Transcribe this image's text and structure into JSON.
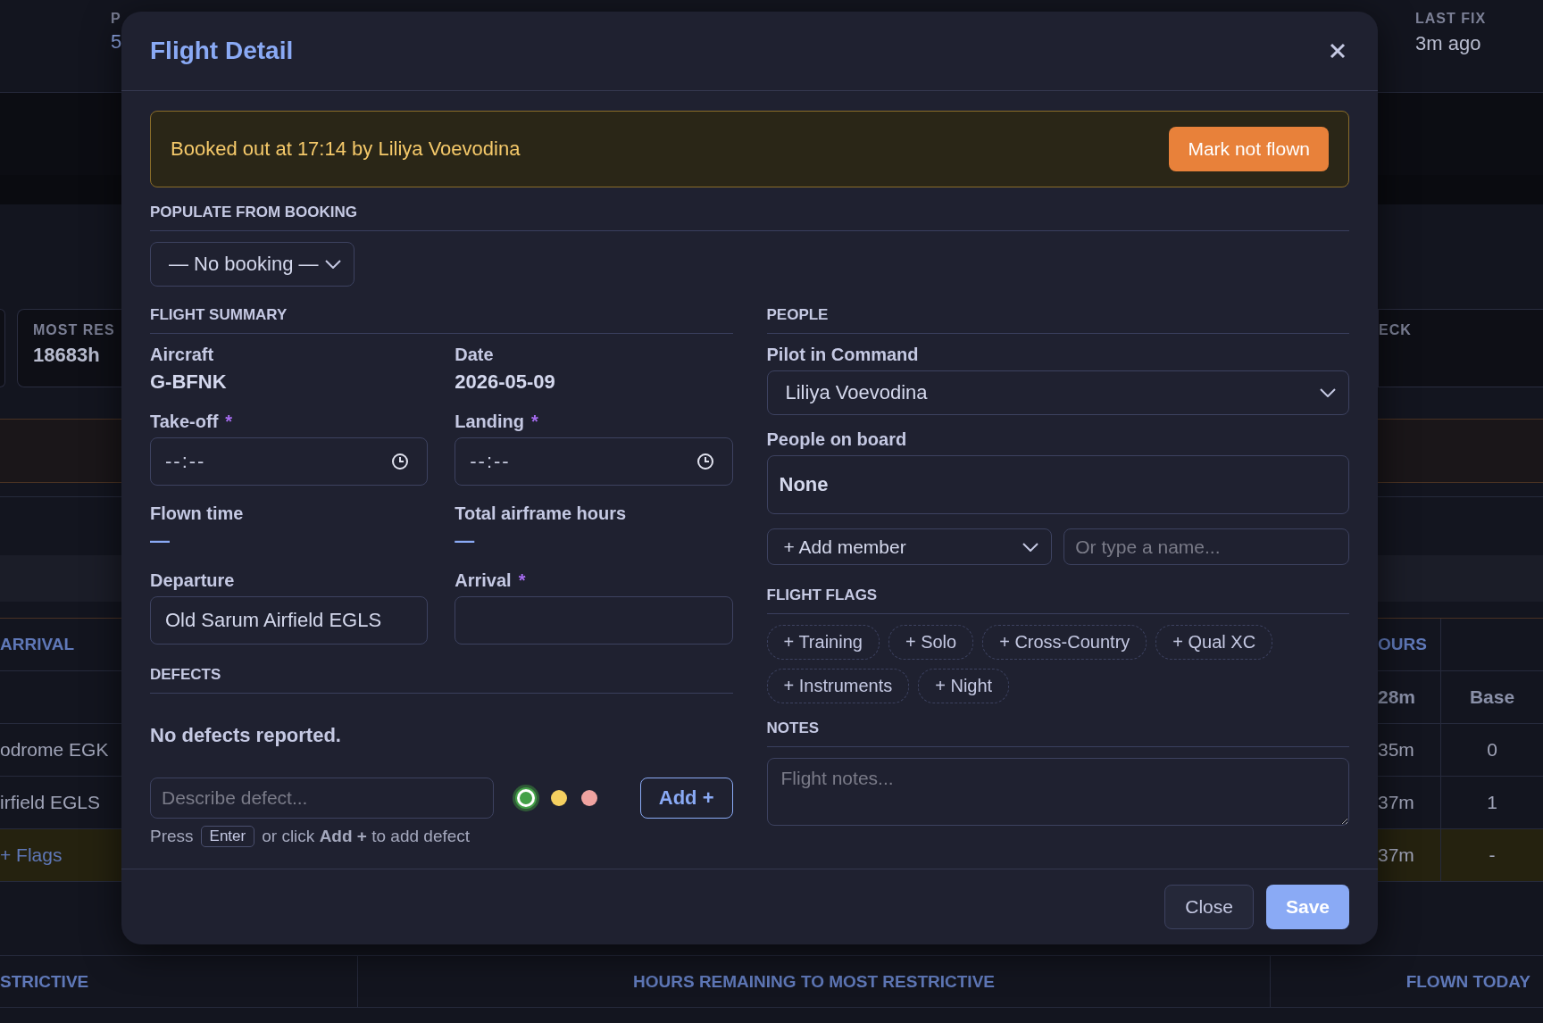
{
  "background": {
    "header_left": {
      "label": "P",
      "value": "5"
    },
    "last_fix": {
      "label": "LAST FIX",
      "value": "3m ago"
    },
    "stat_left": {
      "label": "MOST RES",
      "value": "18683h"
    },
    "stat_right": {
      "label": "ECK"
    },
    "table": {
      "column_1": "ARRIVAL",
      "column_2": "OURS",
      "rows": [
        {
          "kind": "subheader",
          "hours": "28m",
          "column_3": "Base",
          "highlighted": false
        },
        {
          "kind": "data",
          "arrival": "odrome EGK",
          "hours": "35m",
          "column_3": "0",
          "highlighted": false
        },
        {
          "kind": "data",
          "arrival": "irfield EGLS",
          "hours": "37m",
          "column_3": "1",
          "highlighted": false
        },
        {
          "kind": "link",
          "arrival": "+ Flags",
          "hours": "37m",
          "column_3": "-",
          "highlighted": true
        }
      ]
    },
    "bottom_table": {
      "columns": [
        "STRICTIVE",
        "HOURS REMAINING TO MOST RESTRICTIVE",
        "FLOWN TODAY"
      ]
    }
  },
  "dialog": {
    "title": "Flight Detail",
    "banner": {
      "text": "Booked out at 17:14 by Liliya Voevodina",
      "button": "Mark not flown"
    },
    "populate": {
      "heading": "POPULATE FROM BOOKING",
      "value": "— No booking —"
    },
    "summary": {
      "heading": "FLIGHT SUMMARY",
      "fields": [
        {
          "kind": "static",
          "label": "Aircraft",
          "value": "G-BFNK"
        },
        {
          "kind": "static",
          "label": "Date",
          "value": "2026-05-09"
        },
        {
          "kind": "time",
          "label": "Take-off",
          "required_mark": "*",
          "value": "--:--"
        },
        {
          "kind": "time",
          "label": "Landing",
          "required_mark": "*",
          "value": "--:--"
        },
        {
          "kind": "empty",
          "label": "Flown time",
          "value": "—"
        },
        {
          "kind": "empty",
          "label": "Total airframe hours",
          "value": "—"
        },
        {
          "kind": "text",
          "label": "Departure",
          "value": "Old Sarum Airfield EGLS"
        },
        {
          "kind": "text",
          "label": "Arrival",
          "required_mark": "*"
        }
      ]
    },
    "defects": {
      "heading": "DEFECTS",
      "empty_text": "No defects reported.",
      "placeholder": "Describe defect...",
      "severities": [
        {
          "color": "#43a047",
          "selected": true
        },
        {
          "color": "#f5d060",
          "selected": false
        },
        {
          "color": "#f0a3a0",
          "selected": false
        }
      ],
      "add_button": "Add +",
      "hint_start": "Press",
      "hint_key": "Enter",
      "hint_end": "or click **Add +** to add defect"
    },
    "people": {
      "heading": "PEOPLE",
      "pilot_label": "Pilot in Command",
      "pilot_value": "Liliya Voevodina",
      "on_board_label": "People on board",
      "on_board_value": "None",
      "add_member": "+ Add member",
      "name_placeholder": "Or type a name..."
    },
    "flags": {
      "heading": "FLIGHT FLAGS",
      "chips": [
        {
          "label": "+ Training",
          "selected": false
        },
        {
          "label": "+ Solo",
          "selected": false
        },
        {
          "label": "+ Cross-Country",
          "selected": false
        },
        {
          "label": "+ Qual XC",
          "selected": false
        },
        {
          "label": "+ Instruments",
          "selected": false
        },
        {
          "label": "+ Night",
          "selected": false
        }
      ]
    },
    "notes": {
      "heading": "NOTES",
      "placeholder": "Flight notes..."
    },
    "buttons": [
      {
        "kind": "secondary",
        "label": "Close"
      },
      {
        "kind": "primary",
        "label": "Save"
      }
    ]
  }
}
